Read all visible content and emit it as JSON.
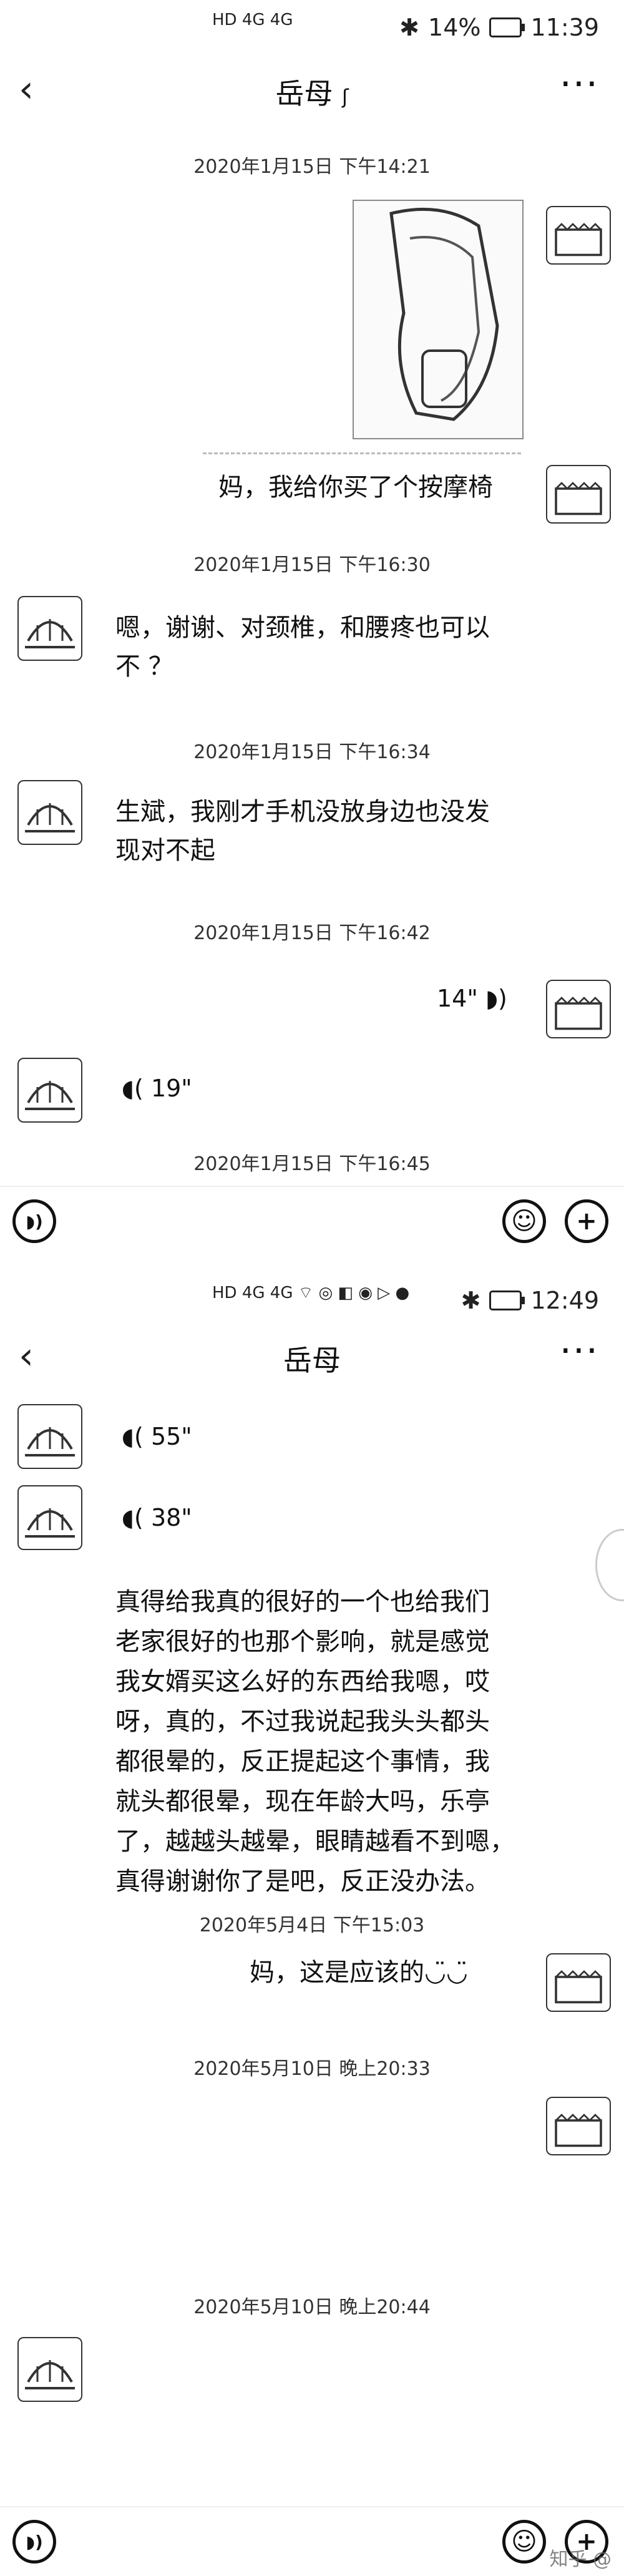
{
  "screen1": {
    "status": {
      "signal": "HD 4G 4G",
      "battery": "14%",
      "time": "11:39"
    },
    "title": "岳母",
    "messages": [
      {
        "type": "timestamp",
        "text": "2020年1月15日 下午14:21"
      },
      {
        "type": "image",
        "from": "me"
      },
      {
        "type": "text",
        "from": "me",
        "text": "妈，我给你买了个按摩椅"
      },
      {
        "type": "timestamp",
        "text": "2020年1月15日 下午16:30"
      },
      {
        "type": "text",
        "from": "other",
        "lines": [
          "嗯，谢谢、对颈椎，和腰疼也可以",
          "不 ？"
        ]
      },
      {
        "type": "timestamp",
        "text": "2020年1月15日 下午16:34"
      },
      {
        "type": "text",
        "from": "other",
        "lines": [
          "生斌，我刚才手机没放身边也没发",
          "现对不起"
        ]
      },
      {
        "type": "timestamp",
        "text": "2020年1月15日 下午16:42"
      },
      {
        "type": "voice",
        "from": "me",
        "duration": "14\""
      },
      {
        "type": "voice",
        "from": "other",
        "duration": "19\""
      },
      {
        "type": "timestamp",
        "text": "2020年1月15日 下午16:45"
      }
    ]
  },
  "screen2": {
    "status": {
      "battery": "",
      "time": "12:49"
    },
    "title": "岳母",
    "messages": [
      {
        "type": "voice",
        "from": "other",
        "duration": "55\""
      },
      {
        "type": "voice",
        "from": "other",
        "duration": "38\""
      },
      {
        "type": "transcript",
        "lines": [
          "真得给我真的很好的一个也给我们",
          "老家很好的也那个影响，就是感觉",
          "我女婿买这么好的东西给我嗯，哎",
          "呀，真的，不过我说起我头头都头",
          "都很晕的，反正提起这个事情，我",
          "就头都很晕，现在年龄大吗，乐亭",
          "了，越越头越晕，眼睛越看不到嗯，",
          "真得谢谢你了是吧，反正没办法。"
        ]
      },
      {
        "type": "timestamp",
        "text": "2020年5月4日 下午15:03"
      },
      {
        "type": "text",
        "from": "me",
        "text": "妈，这是应该的◡̈◡̈"
      },
      {
        "type": "timestamp",
        "text": "2020年5月10日 晚上20:33"
      },
      {
        "type": "timestamp",
        "text": "2020年5月10日 晚上20:44"
      }
    ]
  },
  "icons": {
    "back": "‹",
    "more": "···",
    "voice_wave": "◗)",
    "emoji": "☺",
    "plus": "+"
  },
  "watermark": "知乎 @"
}
